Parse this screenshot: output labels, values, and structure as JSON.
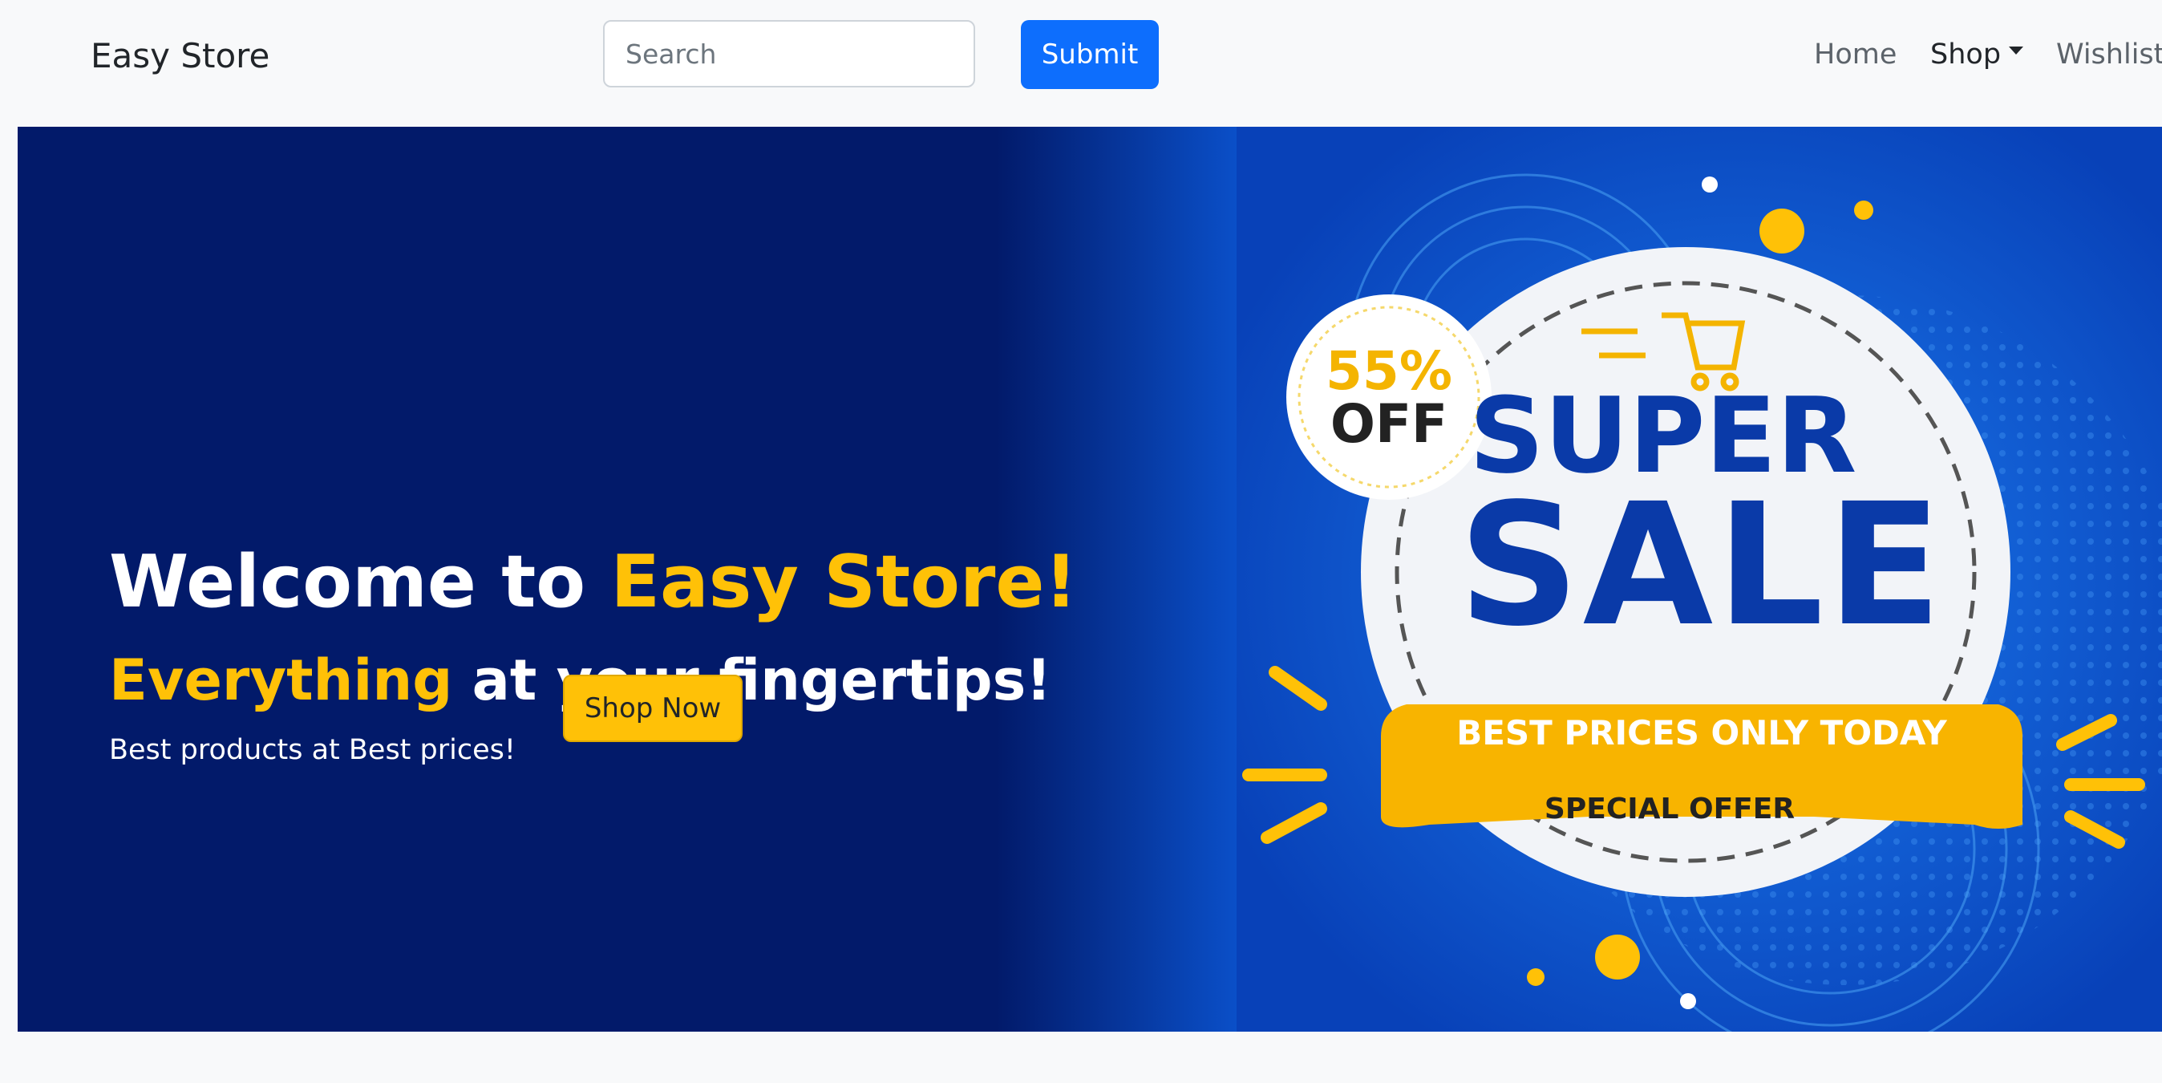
{
  "navbar": {
    "brand": "Easy Store",
    "search_placeholder": "Search",
    "search_value": "",
    "submit_label": "Submit",
    "links": {
      "home": "Home",
      "shop": "Shop",
      "wishlist": "Wishlist"
    }
  },
  "hero": {
    "title_prefix": "Welcome to ",
    "title_highlight": "Easy Store!",
    "subtitle_highlight": "Everything",
    "subtitle_rest": " at your fingertips!",
    "tagline": "Best products at Best prices!",
    "cta_label": "Shop Now"
  },
  "banner": {
    "discount_value": "55%",
    "discount_suffix": "OFF",
    "headline_top": "SUPER",
    "headline_main": "SALE",
    "ribbon_text": "BEST PRICES ONLY TODAY",
    "offer_text": "SPECIAL OFFER"
  },
  "colors": {
    "primary": "#0d6efd",
    "accent_yellow": "#ffc107",
    "hero_navy": "#021a6a",
    "banner_blue": "#0a4fc8"
  }
}
